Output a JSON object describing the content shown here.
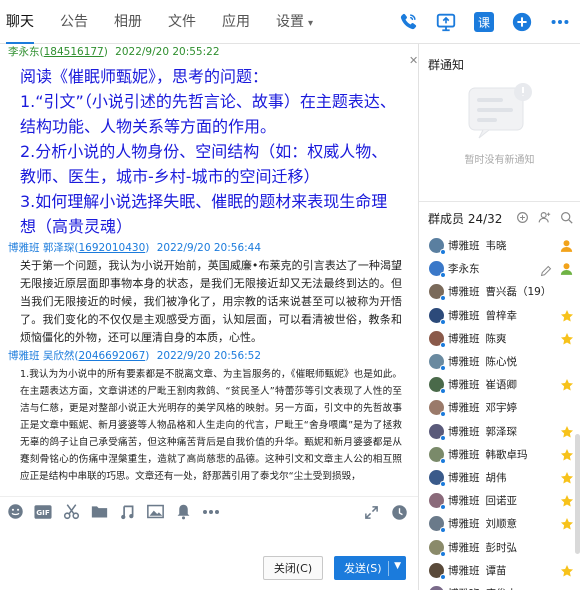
{
  "tabs": [
    {
      "label": "聊天",
      "active": true
    },
    {
      "label": "公告"
    },
    {
      "label": "相册"
    },
    {
      "label": "文件"
    },
    {
      "label": "应用"
    },
    {
      "label": "设置",
      "has_caret": true
    }
  ],
  "top_icons": [
    "phone-icon",
    "screen-share-icon",
    "course-icon",
    "add-icon",
    "more-icon"
  ],
  "course_icon_label": "课",
  "messages": [
    {
      "sender": "李永东",
      "uid": "184516177",
      "time": "2022/9/20 20:55:22",
      "lines": [
        "阅读《催眠师甄妮》，思考的问题：",
        "1.“引文”（小说引述的先哲言论、故事）在主题表达、结构功能、人物关系等方面的作用。",
        "2.分析小说的人物身份、空间结构（如：权威人物、教师、医生，城市-乡村-城市的空间迁移）",
        "3.如何理解小说选择失眠、催眠的题材来表现生命理想（高贵灵魂）"
      ]
    },
    {
      "sender": "博雅班 郭泽琛",
      "uid": "1692010430",
      "time": "2022/9/20 20:56:44",
      "text": "关于第一个问题，我认为小说开始前，英国威廉•布莱克的引言表达了一种渴望无限接近原层面即事物本身的状态，是我们无限接近却又无法最终到达的。但当我们无限接近的时候，我们被净化了，用宗教的话来说甚至可以被称为开悟了。我们变化的不仅仅是主观感受方面，认知层面，可以看清被世俗，教条和烦恼僵化的外物，还可以厘清自身的本质，心性。"
    },
    {
      "sender": "博雅班 吴欣然",
      "uid": "2046692067",
      "time": "2022/9/20 20:56:52",
      "text": "1.我认为为小说中的所有要素都是不脱离文章、为主旨服务的，《催眠师甄妮》也是如此。在主题表达方面，文章讲述的尸毗王割肉救鸽、“贫民圣人”特蕾莎等引文表现了人性的至洁与仁慈，更是对整部小说正大光明存的美学风格的映射。另一方面，引文中的先哲故事正是文章中甄妮、新月婆婆等人物品格和人生走向的代言，尸毗王“舍身喂鹰”是为了拯救无辜的鸽子让自己承受痛苦，但这种痛苦背后是自我价值的升华。甄妮和新月婆婆都是从蹇刻骨铭心的伤痛中涅槃重生，造就了高尚慈悲的品德。这种引文和文章主人公的相互照应正是结构中串联的巧思。文章还有一处，舒那茜引用了泰戈尔“尘土受到损毁，"
    }
  ],
  "buttons": {
    "close": "关闭(C)",
    "send": "发送(S)"
  },
  "notice": {
    "title": "群通知",
    "empty": "暂时没有新通知"
  },
  "members": {
    "title": "群成员 24/32",
    "list": [
      {
        "cls": "博雅班",
        "name": "韦晓",
        "avatar": "#5a7fa0",
        "badge": "owner"
      },
      {
        "cls": "",
        "name": "李永东",
        "avatar": "#3a78c8",
        "badge": "admin",
        "edit": true
      },
      {
        "cls": "博雅班",
        "name": "曹兴磊（19）",
        "avatar": "#7a6a5a"
      },
      {
        "cls": "博雅班",
        "name": "曾梓幸",
        "avatar": "#2c4a7a",
        "badge": "star"
      },
      {
        "cls": "博雅班",
        "name": "陈爽",
        "avatar": "#8a5a4a",
        "badge": "star"
      },
      {
        "cls": "博雅班",
        "name": "陈心悦",
        "avatar": "#6a8aa0"
      },
      {
        "cls": "博雅班",
        "name": "崔语卿",
        "avatar": "#4a6a4a",
        "badge": "star"
      },
      {
        "cls": "博雅班",
        "name": "邓宇婷",
        "avatar": "#9a7a6a"
      },
      {
        "cls": "博雅班",
        "name": "郭泽琛",
        "avatar": "#5a5a7a",
        "badge": "star"
      },
      {
        "cls": "博雅班",
        "name": "韩歌卓玛",
        "avatar": "#7a8a6a",
        "badge": "star"
      },
      {
        "cls": "博雅班",
        "name": "胡伟",
        "avatar": "#3a5a8a",
        "badge": "star"
      },
      {
        "cls": "博雅班",
        "name": "回诺亚",
        "avatar": "#8a6a7a",
        "badge": "star"
      },
      {
        "cls": "博雅班",
        "name": "刘顺意",
        "avatar": "#6a7a8a",
        "badge": "star"
      },
      {
        "cls": "博雅班",
        "name": "彭时弘",
        "avatar": "#8a8a6a"
      },
      {
        "cls": "博雅班",
        "name": "谭苗",
        "avatar": "#5a4a3a",
        "badge": "star"
      },
      {
        "cls": "博雅班",
        "name": "唐俊杰",
        "avatar": "#7a6a8a"
      }
    ]
  },
  "colors": {
    "accent": "#1b7bdc",
    "owner_admin": "#f2a31b",
    "star": "#f7c21b",
    "message_big": "#1a1adb"
  }
}
